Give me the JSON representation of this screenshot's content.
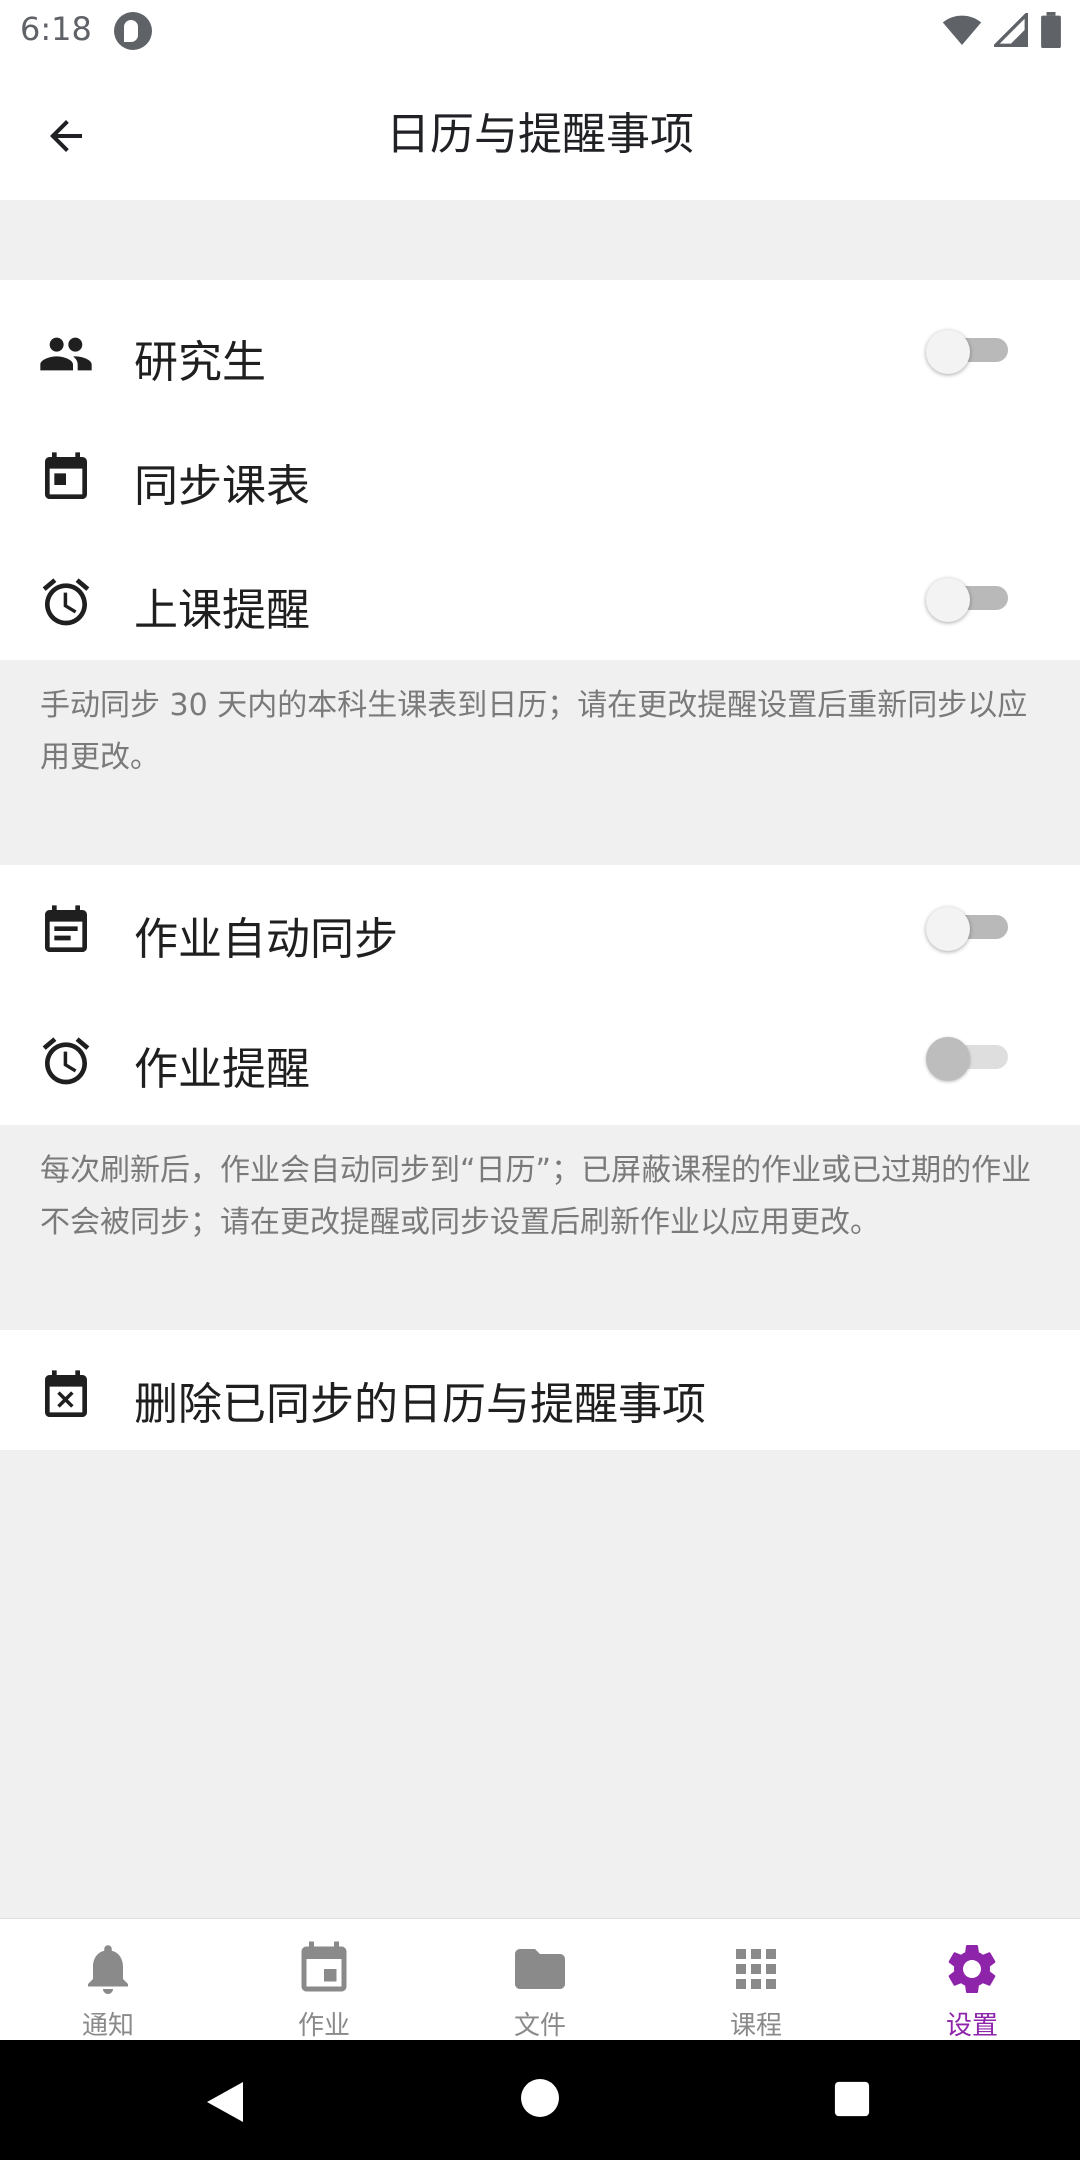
{
  "status_bar": {
    "time": "6:18"
  },
  "app_bar": {
    "title": "日历与提醒事项"
  },
  "section1": {
    "rows": [
      {
        "label": "研究生",
        "has_switch": true
      },
      {
        "label": "同步课表",
        "has_switch": false
      },
      {
        "label": "上课提醒",
        "has_switch": true
      }
    ],
    "note": "手动同步 30 天内的本科生课表到日历；请在更改提醒设置后重新同步以应用更改。"
  },
  "section2": {
    "rows": [
      {
        "label": "作业自动同步",
        "has_switch": true
      },
      {
        "label": "作业提醒",
        "has_switch": true,
        "disabled": true
      }
    ],
    "note": "每次刷新后，作业会自动同步到“日历”；已屏蔽课程的作业或已过期的作业不会被同步；请在更改提醒或同步设置后刷新作业以应用更改。"
  },
  "section3": {
    "rows": [
      {
        "label": "删除已同步的日历与提醒事项"
      }
    ]
  },
  "bottom_nav": {
    "items": [
      {
        "label": "通知",
        "icon": "bell-icon"
      },
      {
        "label": "作业",
        "icon": "calendar-icon"
      },
      {
        "label": "文件",
        "icon": "folder-icon"
      },
      {
        "label": "课程",
        "icon": "grid-icon"
      },
      {
        "label": "设置",
        "icon": "gear-icon",
        "active": true
      }
    ]
  },
  "colors": {
    "accent": "#8e24aa",
    "background": "#f0f0f0",
    "note_text": "#7a7a7a"
  }
}
